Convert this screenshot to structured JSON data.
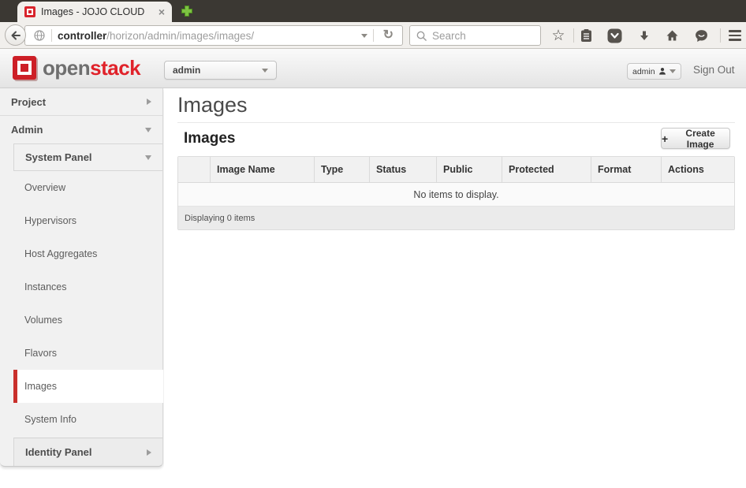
{
  "colors": {
    "brand_red": "#e0222a",
    "active_item_red": "#c9302c",
    "new_tab_green": "#7dc242",
    "titlebar_dark": "#3b3833",
    "toolbar_bg": "#f1efec",
    "sidebar_bg": "#f1f1f1"
  },
  "icons": {
    "favicon": "openstack-cube",
    "tab_close": "close-x",
    "new_tab": "plus",
    "back": "arrow-left",
    "page_identity": "globe",
    "url_dropdown": "caret-down",
    "reload": "refresh-arrow",
    "search": "magnifier",
    "bookmark": "star-outline",
    "bookmarks_menu": "clipboard-list",
    "pocket": "chevron-down-badge",
    "downloads": "arrow-down",
    "home": "house",
    "hello": "chat-smiley",
    "menu": "hamburger",
    "user": "person",
    "sidebar_collapsed": "caret-right",
    "sidebar_expanded": "caret-down",
    "create": "plus"
  },
  "browser": {
    "tab": {
      "title": "Images - JOJO CLOUD",
      "close_label": "×"
    },
    "toolbar": {
      "url_host": "controller",
      "url_path": "/horizon/admin/images/images/",
      "reload_glyph": "↻",
      "search_placeholder": "Search",
      "star_glyph": "☆"
    }
  },
  "header": {
    "logo_open": "open",
    "logo_stack": "stack",
    "project_selector_value": "admin",
    "user_menu_label": "admin",
    "sign_out_label": "Sign Out"
  },
  "sidebar": {
    "project_label": "Project",
    "admin_label": "Admin",
    "system_panel_label": "System Panel",
    "items": [
      "Overview",
      "Hypervisors",
      "Host Aggregates",
      "Instances",
      "Volumes",
      "Flavors",
      "Images",
      "System Info"
    ],
    "active_item": "Images",
    "identity_panel_label": "Identity Panel"
  },
  "main": {
    "page_title": "Images",
    "panel_title": "Images",
    "create_image_button": {
      "icon": "+",
      "label": "Create Image"
    },
    "table": {
      "columns": [
        "Image Name",
        "Type",
        "Status",
        "Public",
        "Protected",
        "Format",
        "Actions"
      ],
      "empty_message": "No items to display.",
      "footer_text": "Displaying 0 items"
    }
  }
}
